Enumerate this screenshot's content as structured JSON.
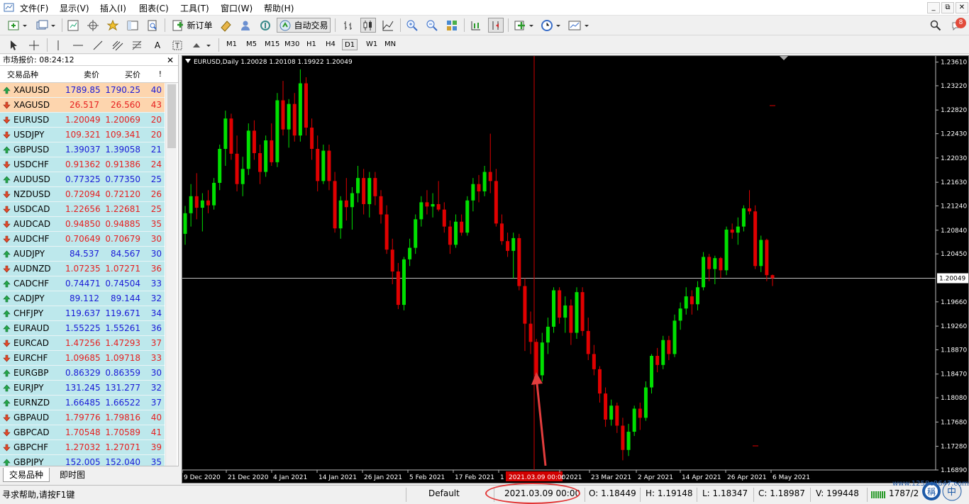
{
  "menu": {
    "items": [
      "文件(F)",
      "显示(V)",
      "插入(I)",
      "图表(C)",
      "工具(T)",
      "窗口(W)",
      "帮助(H)"
    ],
    "win_controls": [
      "_",
      "⧉",
      "✕"
    ],
    "notification_count": "8"
  },
  "toolbar": {
    "new_order_label": "新订单",
    "auto_trade_label": "自动交易",
    "timeframes": [
      "M1",
      "M5",
      "M15",
      "M30",
      "H1",
      "H4",
      "D1",
      "W1",
      "MN"
    ],
    "active_timeframe": "D1",
    "text_tool_label": "A"
  },
  "market_watch": {
    "title": "市场报价: 08:24:12",
    "close_icon": "close-icon",
    "columns": {
      "symbol": "交易品种",
      "bid": "卖价",
      "ask": "买价",
      "spread": "!"
    },
    "rows": [
      {
        "symbol": "XAUUSD",
        "bid": "1789.85",
        "ask": "1790.25",
        "spread": "40",
        "dir": "up",
        "bg": "gold"
      },
      {
        "symbol": "XAGUSD",
        "bid": "26.517",
        "ask": "26.560",
        "spread": "43",
        "dir": "down",
        "bg": "gold"
      },
      {
        "symbol": "EURUSD",
        "bid": "1.20049",
        "ask": "1.20069",
        "spread": "20",
        "dir": "down",
        "bg": "cyan"
      },
      {
        "symbol": "USDJPY",
        "bid": "109.321",
        "ask": "109.341",
        "spread": "20",
        "dir": "down",
        "bg": "cyan"
      },
      {
        "symbol": "GBPUSD",
        "bid": "1.39037",
        "ask": "1.39058",
        "spread": "21",
        "dir": "up",
        "bg": "cyan"
      },
      {
        "symbol": "USDCHF",
        "bid": "0.91362",
        "ask": "0.91386",
        "spread": "24",
        "dir": "down",
        "bg": "cyan"
      },
      {
        "symbol": "AUDUSD",
        "bid": "0.77325",
        "ask": "0.77350",
        "spread": "25",
        "dir": "up",
        "bg": "cyan"
      },
      {
        "symbol": "NZDUSD",
        "bid": "0.72094",
        "ask": "0.72120",
        "spread": "26",
        "dir": "down",
        "bg": "cyan"
      },
      {
        "symbol": "USDCAD",
        "bid": "1.22656",
        "ask": "1.22681",
        "spread": "25",
        "dir": "down",
        "bg": "cyan"
      },
      {
        "symbol": "AUDCAD",
        "bid": "0.94850",
        "ask": "0.94885",
        "spread": "35",
        "dir": "down",
        "bg": "cyan"
      },
      {
        "symbol": "AUDCHF",
        "bid": "0.70649",
        "ask": "0.70679",
        "spread": "30",
        "dir": "down",
        "bg": "cyan"
      },
      {
        "symbol": "AUDJPY",
        "bid": "84.537",
        "ask": "84.567",
        "spread": "30",
        "dir": "up",
        "bg": "cyan"
      },
      {
        "symbol": "AUDNZD",
        "bid": "1.07235",
        "ask": "1.07271",
        "spread": "36",
        "dir": "down",
        "bg": "cyan"
      },
      {
        "symbol": "CADCHF",
        "bid": "0.74471",
        "ask": "0.74504",
        "spread": "33",
        "dir": "up",
        "bg": "cyan"
      },
      {
        "symbol": "CADJPY",
        "bid": "89.112",
        "ask": "89.144",
        "spread": "32",
        "dir": "up",
        "bg": "cyan"
      },
      {
        "symbol": "CHFJPY",
        "bid": "119.637",
        "ask": "119.671",
        "spread": "34",
        "dir": "up",
        "bg": "cyan"
      },
      {
        "symbol": "EURAUD",
        "bid": "1.55225",
        "ask": "1.55261",
        "spread": "36",
        "dir": "up",
        "bg": "cyan"
      },
      {
        "symbol": "EURCAD",
        "bid": "1.47256",
        "ask": "1.47293",
        "spread": "37",
        "dir": "down",
        "bg": "cyan"
      },
      {
        "symbol": "EURCHF",
        "bid": "1.09685",
        "ask": "1.09718",
        "spread": "33",
        "dir": "down",
        "bg": "cyan"
      },
      {
        "symbol": "EURGBP",
        "bid": "0.86329",
        "ask": "0.86359",
        "spread": "30",
        "dir": "up",
        "bg": "cyan"
      },
      {
        "symbol": "EURJPY",
        "bid": "131.245",
        "ask": "131.277",
        "spread": "32",
        "dir": "up",
        "bg": "cyan"
      },
      {
        "symbol": "EURNZD",
        "bid": "1.66485",
        "ask": "1.66522",
        "spread": "37",
        "dir": "up",
        "bg": "cyan"
      },
      {
        "symbol": "GBPAUD",
        "bid": "1.79776",
        "ask": "1.79816",
        "spread": "40",
        "dir": "down",
        "bg": "cyan"
      },
      {
        "symbol": "GBPCAD",
        "bid": "1.70548",
        "ask": "1.70589",
        "spread": "41",
        "dir": "down",
        "bg": "cyan"
      },
      {
        "symbol": "GBPCHF",
        "bid": "1.27032",
        "ask": "1.27071",
        "spread": "39",
        "dir": "down",
        "bg": "cyan"
      },
      {
        "symbol": "GBPJPY",
        "bid": "152.005",
        "ask": "152.040",
        "spread": "35",
        "dir": "up",
        "bg": "cyan"
      }
    ],
    "tabs": [
      "交易品种",
      "即时图"
    ],
    "active_tab": "交易品种"
  },
  "chart": {
    "header": "EURUSD,Daily  1.20028 1.20108 1.19922 1.20049",
    "bid_label": "1.20049",
    "crosshair_date": "2021.03.09 00:00",
    "x_labels": [
      "9 Dec 2020",
      "21 Dec 2020",
      "4 Jan 2021",
      "14 Jan 2021",
      "26 Jan 2021",
      "5 Feb 2021",
      "17 Feb 2021",
      "1",
      "r 2021",
      "23 Mar 2021",
      "2 Apr 2021",
      "14 Apr 2021",
      "26 Apr 2021",
      "6 May 2021"
    ],
    "colors": {
      "bull": "#00e000",
      "bear": "#e00000",
      "background": "#000000",
      "grid_line": "#c0c0c0",
      "crosshair": "#d00000",
      "annotation": "#e23d3d"
    }
  },
  "chart_data": {
    "type": "candlestick",
    "title": "EURUSD,Daily",
    "ohlc_current": {
      "open": 1.20028,
      "high": 1.20108,
      "low": 1.19922,
      "close": 1.20049
    },
    "y_ticks": [
      "1.23610",
      "1.23220",
      "1.22820",
      "1.22430",
      "1.22030",
      "1.21630",
      "1.21240",
      "1.20840",
      "1.20450",
      "1.20049",
      "1.19660",
      "1.19260",
      "1.18870",
      "1.18470",
      "1.18080",
      "1.17680",
      "1.17280",
      "1.16890"
    ],
    "ylim": [
      1.1689,
      1.2371
    ],
    "bid_line": 1.20049,
    "candles": [
      {
        "o": 1.2078,
        "h": 1.2124,
        "l": 1.206,
        "c": 1.2112
      },
      {
        "o": 1.2112,
        "h": 1.216,
        "l": 1.209,
        "c": 1.214
      },
      {
        "o": 1.214,
        "h": 1.2178,
        "l": 1.2102,
        "c": 1.2121
      },
      {
        "o": 1.2121,
        "h": 1.2145,
        "l": 1.2082,
        "c": 1.2133
      },
      {
        "o": 1.2133,
        "h": 1.215,
        "l": 1.2112,
        "c": 1.2125
      },
      {
        "o": 1.2125,
        "h": 1.217,
        "l": 1.2118,
        "c": 1.2162
      },
      {
        "o": 1.2162,
        "h": 1.2225,
        "l": 1.215,
        "c": 1.2218
      },
      {
        "o": 1.2218,
        "h": 1.2281,
        "l": 1.219,
        "c": 1.2268
      },
      {
        "o": 1.2268,
        "h": 1.2276,
        "l": 1.22,
        "c": 1.221
      },
      {
        "o": 1.221,
        "h": 1.224,
        "l": 1.2148,
        "c": 1.216
      },
      {
        "o": 1.216,
        "h": 1.2205,
        "l": 1.214,
        "c": 1.2185
      },
      {
        "o": 1.2185,
        "h": 1.226,
        "l": 1.2175,
        "c": 1.2248
      },
      {
        "o": 1.2248,
        "h": 1.2265,
        "l": 1.22,
        "c": 1.2211
      },
      {
        "o": 1.2211,
        "h": 1.2225,
        "l": 1.216,
        "c": 1.218
      },
      {
        "o": 1.218,
        "h": 1.224,
        "l": 1.2172,
        "c": 1.2232
      },
      {
        "o": 1.2232,
        "h": 1.226,
        "l": 1.219,
        "c": 1.2196
      },
      {
        "o": 1.2196,
        "h": 1.231,
        "l": 1.2188,
        "c": 1.2298
      },
      {
        "o": 1.2298,
        "h": 1.233,
        "l": 1.224,
        "c": 1.225
      },
      {
        "o": 1.225,
        "h": 1.23,
        "l": 1.222,
        "c": 1.2292
      },
      {
        "o": 1.2292,
        "h": 1.231,
        "l": 1.223,
        "c": 1.224
      },
      {
        "o": 1.224,
        "h": 1.2349,
        "l": 1.223,
        "c": 1.2326
      },
      {
        "o": 1.2326,
        "h": 1.2336,
        "l": 1.224,
        "c": 1.2253
      },
      {
        "o": 1.2253,
        "h": 1.2268,
        "l": 1.22,
        "c": 1.2218
      },
      {
        "o": 1.2218,
        "h": 1.224,
        "l": 1.2148,
        "c": 1.2165
      },
      {
        "o": 1.2165,
        "h": 1.2225,
        "l": 1.216,
        "c": 1.2215
      },
      {
        "o": 1.2215,
        "h": 1.2225,
        "l": 1.215,
        "c": 1.2165
      },
      {
        "o": 1.2165,
        "h": 1.218,
        "l": 1.208,
        "c": 1.2087
      },
      {
        "o": 1.2087,
        "h": 1.214,
        "l": 1.207,
        "c": 1.2133
      },
      {
        "o": 1.2133,
        "h": 1.217,
        "l": 1.21,
        "c": 1.2122
      },
      {
        "o": 1.2122,
        "h": 1.2155,
        "l": 1.2085,
        "c": 1.2145
      },
      {
        "o": 1.2145,
        "h": 1.219,
        "l": 1.213,
        "c": 1.217
      },
      {
        "o": 1.217,
        "h": 1.2185,
        "l": 1.211,
        "c": 1.2127
      },
      {
        "o": 1.2127,
        "h": 1.218,
        "l": 1.2105,
        "c": 1.217
      },
      {
        "o": 1.217,
        "h": 1.218,
        "l": 1.2125,
        "c": 1.214
      },
      {
        "o": 1.214,
        "h": 1.215,
        "l": 1.2095,
        "c": 1.211
      },
      {
        "o": 1.211,
        "h": 1.2125,
        "l": 1.2045,
        "c": 1.2052
      },
      {
        "o": 1.2052,
        "h": 1.207,
        "l": 1.1995,
        "c": 1.2016
      },
      {
        "o": 1.2016,
        "h": 1.203,
        "l": 1.1954,
        "c": 1.1961
      },
      {
        "o": 1.1961,
        "h": 1.204,
        "l": 1.1952,
        "c": 1.2036
      },
      {
        "o": 1.2036,
        "h": 1.207,
        "l": 1.2025,
        "c": 1.2055
      },
      {
        "o": 1.2055,
        "h": 1.211,
        "l": 1.2045,
        "c": 1.2102
      },
      {
        "o": 1.2102,
        "h": 1.214,
        "l": 1.209,
        "c": 1.213
      },
      {
        "o": 1.213,
        "h": 1.215,
        "l": 1.211,
        "c": 1.2123
      },
      {
        "o": 1.2123,
        "h": 1.2145,
        "l": 1.2105,
        "c": 1.2127
      },
      {
        "o": 1.2127,
        "h": 1.2165,
        "l": 1.2115,
        "c": 1.2118
      },
      {
        "o": 1.2118,
        "h": 1.213,
        "l": 1.208,
        "c": 1.209
      },
      {
        "o": 1.209,
        "h": 1.21,
        "l": 1.2045,
        "c": 1.206
      },
      {
        "o": 1.206,
        "h": 1.211,
        "l": 1.2055,
        "c": 1.2098
      },
      {
        "o": 1.2098,
        "h": 1.211,
        "l": 1.2075,
        "c": 1.208
      },
      {
        "o": 1.208,
        "h": 1.214,
        "l": 1.2075,
        "c": 1.2133
      },
      {
        "o": 1.2133,
        "h": 1.217,
        "l": 1.2115,
        "c": 1.216
      },
      {
        "o": 1.216,
        "h": 1.2175,
        "l": 1.213,
        "c": 1.2148
      },
      {
        "o": 1.2148,
        "h": 1.219,
        "l": 1.214,
        "c": 1.218
      },
      {
        "o": 1.218,
        "h": 1.2243,
        "l": 1.2145,
        "c": 1.2165
      },
      {
        "o": 1.2165,
        "h": 1.2185,
        "l": 1.209,
        "c": 1.2095
      },
      {
        "o": 1.2095,
        "h": 1.211,
        "l": 1.206,
        "c": 1.2066
      },
      {
        "o": 1.2066,
        "h": 1.208,
        "l": 1.204,
        "c": 1.205
      },
      {
        "o": 1.205,
        "h": 1.208,
        "l": 1.2005,
        "c": 1.2071
      },
      {
        "o": 1.2071,
        "h": 1.2078,
        "l": 1.1985,
        "c": 1.1992
      },
      {
        "o": 1.1992,
        "h": 1.2005,
        "l": 1.1885,
        "c": 1.193
      },
      {
        "o": 1.193,
        "h": 1.195,
        "l": 1.188,
        "c": 1.19
      },
      {
        "o": 1.19,
        "h": 1.1905,
        "l": 1.1835,
        "c": 1.1845
      },
      {
        "o": 1.1845,
        "h": 1.1915,
        "l": 1.1835,
        "c": 1.1899
      },
      {
        "o": 1.1899,
        "h": 1.194,
        "l": 1.188,
        "c": 1.1925
      },
      {
        "o": 1.1925,
        "h": 1.199,
        "l": 1.1915,
        "c": 1.1985
      },
      {
        "o": 1.1985,
        "h": 1.199,
        "l": 1.193,
        "c": 1.194
      },
      {
        "o": 1.194,
        "h": 1.1975,
        "l": 1.1915,
        "c": 1.196
      },
      {
        "o": 1.196,
        "h": 1.197,
        "l": 1.1895,
        "c": 1.1915
      },
      {
        "o": 1.1915,
        "h": 1.199,
        "l": 1.1905,
        "c": 1.1982
      },
      {
        "o": 1.1982,
        "h": 1.199,
        "l": 1.191,
        "c": 1.1918
      },
      {
        "o": 1.1918,
        "h": 1.194,
        "l": 1.187,
        "c": 1.188
      },
      {
        "o": 1.188,
        "h": 1.1895,
        "l": 1.1845,
        "c": 1.1855
      },
      {
        "o": 1.1855,
        "h": 1.186,
        "l": 1.18,
        "c": 1.1815
      },
      {
        "o": 1.1815,
        "h": 1.1825,
        "l": 1.176,
        "c": 1.1772
      },
      {
        "o": 1.1772,
        "h": 1.1805,
        "l": 1.1762,
        "c": 1.1795
      },
      {
        "o": 1.1795,
        "h": 1.18,
        "l": 1.175,
        "c": 1.1762
      },
      {
        "o": 1.1762,
        "h": 1.1775,
        "l": 1.1705,
        "c": 1.1722
      },
      {
        "o": 1.1722,
        "h": 1.1765,
        "l": 1.1712,
        "c": 1.1752
      },
      {
        "o": 1.1752,
        "h": 1.1795,
        "l": 1.1745,
        "c": 1.179
      },
      {
        "o": 1.179,
        "h": 1.18,
        "l": 1.1755,
        "c": 1.1775
      },
      {
        "o": 1.1775,
        "h": 1.1835,
        "l": 1.177,
        "c": 1.1825
      },
      {
        "o": 1.1825,
        "h": 1.188,
        "l": 1.1815,
        "c": 1.1877
      },
      {
        "o": 1.1877,
        "h": 1.189,
        "l": 1.185,
        "c": 1.1862
      },
      {
        "o": 1.1862,
        "h": 1.191,
        "l": 1.1855,
        "c": 1.1903
      },
      {
        "o": 1.1903,
        "h": 1.191,
        "l": 1.187,
        "c": 1.188
      },
      {
        "o": 1.188,
        "h": 1.1945,
        "l": 1.1875,
        "c": 1.1935
      },
      {
        "o": 1.1935,
        "h": 1.1965,
        "l": 1.192,
        "c": 1.1955
      },
      {
        "o": 1.1955,
        "h": 1.199,
        "l": 1.1945,
        "c": 1.1975
      },
      {
        "o": 1.1975,
        "h": 1.1985,
        "l": 1.1945,
        "c": 1.1962
      },
      {
        "o": 1.1962,
        "h": 1.2,
        "l": 1.1952,
        "c": 1.199
      },
      {
        "o": 1.199,
        "h": 1.2048,
        "l": 1.1985,
        "c": 1.204
      },
      {
        "o": 1.204,
        "h": 1.2045,
        "l": 1.2,
        "c": 1.202
      },
      {
        "o": 1.202,
        "h": 1.2042,
        "l": 1.1995,
        "c": 1.2038
      },
      {
        "o": 1.2038,
        "h": 1.204,
        "l": 1.2005,
        "c": 1.2018
      },
      {
        "o": 1.2018,
        "h": 1.209,
        "l": 1.201,
        "c": 1.2085
      },
      {
        "o": 1.2085,
        "h": 1.2095,
        "l": 1.207,
        "c": 1.208
      },
      {
        "o": 1.208,
        "h": 1.2105,
        "l": 1.206,
        "c": 1.209
      },
      {
        "o": 1.209,
        "h": 1.2125,
        "l": 1.2082,
        "c": 1.212
      },
      {
        "o": 1.212,
        "h": 1.215,
        "l": 1.211,
        "c": 1.2115
      },
      {
        "o": 1.2115,
        "h": 1.2125,
        "l": 1.202,
        "c": 1.2025
      },
      {
        "o": 1.2025,
        "h": 1.2075,
        "l": 1.2015,
        "c": 1.2068
      },
      {
        "o": 1.2068,
        "h": 1.207,
        "l": 1.2,
        "c": 1.201
      },
      {
        "o": 1.201,
        "h": 1.2011,
        "l": 1.1992,
        "c": 1.2005
      }
    ],
    "annotations": [
      "2021.03.09 00:00"
    ]
  },
  "status": {
    "help": "寻求帮助,请按F1键",
    "profile": "Default",
    "datetime": "2021.03.09 00:00",
    "open": "O: 1.18449",
    "high": "H: 1.19148",
    "low": "L: 1.18347",
    "close": "C: 1.18987",
    "volume": "V: 199448",
    "traffic": "1787/2",
    "watermark": "www.1258c8647.com"
  }
}
